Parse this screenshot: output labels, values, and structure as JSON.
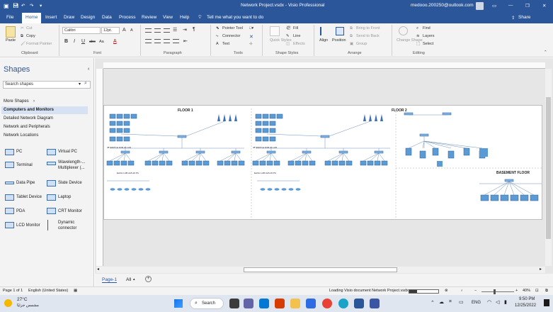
{
  "window": {
    "title": "Network Project.vsdx - Visio Professional",
    "account": "medooo.200250@outlook.com",
    "controls": [
      "—",
      "❐",
      "✕"
    ]
  },
  "ribbon_tabs": [
    "File",
    "Home",
    "Insert",
    "Draw",
    "Design",
    "Data",
    "Process",
    "Review",
    "View",
    "Help"
  ],
  "tell_me": "Tell me what you want to do",
  "share": "Share",
  "ribbon": {
    "clipboard": {
      "paste": "Paste",
      "cut": "Cut",
      "copy": "Copy",
      "format_painter": "Format Painter",
      "label": "Clipboard"
    },
    "font": {
      "family": "Calibri",
      "size": "12pt.",
      "grow": "A",
      "shrink": "A",
      "bold": "B",
      "italic": "I",
      "underline": "U",
      "strike": "abc",
      "case": "Aa",
      "label": "Font"
    },
    "paragraph": {
      "label": "Paragraph"
    },
    "tools": {
      "pointer": "Pointer Tool",
      "connector": "Connector",
      "text": "Text",
      "label": "Tools"
    },
    "shape_styles": {
      "quick_styles": "Quick Styles",
      "fill": "Fill",
      "line": "Line",
      "effects": "Effects",
      "label": "Shape Styles"
    },
    "arrange": {
      "align": "Align",
      "position": "Position",
      "bring_front": "Bring to Front",
      "send_back": "Send to Back",
      "group": "Group",
      "label": "Arrange"
    },
    "editing": {
      "change_shape": "Change Shape",
      "find": "Find",
      "layers": "Layers",
      "select": "Select",
      "label": "Editing"
    }
  },
  "shapes_panel": {
    "title": "Shapes",
    "search_placeholder": "Search shapes",
    "more_shapes": "More Shapes",
    "stencils": [
      "Computers and Monitors",
      "Detailed Network Diagram",
      "Network and Peripherals",
      "Network Locations"
    ],
    "active_stencil": "Computers and Monitors",
    "items": [
      {
        "label": "PC",
        "icon": "pc-icon"
      },
      {
        "label": "Virtual PC",
        "icon": "virtual-pc-icon"
      },
      {
        "label": "Terminal",
        "icon": "terminal-icon"
      },
      {
        "label": "Wavelength-... Multiplexer (...",
        "icon": "multiplexer-icon"
      },
      {
        "label": "Data Pipe",
        "icon": "data-pipe-icon"
      },
      {
        "label": "Slate Device",
        "icon": "slate-device-icon"
      },
      {
        "label": "Tablet Device",
        "icon": "tablet-icon"
      },
      {
        "label": "Laptop",
        "icon": "laptop-icon"
      },
      {
        "label": "PDA",
        "icon": "pda-icon"
      },
      {
        "label": "CRT Monitor",
        "icon": "crt-monitor-icon"
      },
      {
        "label": "LCD Monitor",
        "icon": "lcd-monitor-icon"
      },
      {
        "label": "Dynamic connector",
        "icon": "dynamic-connector-icon"
      }
    ]
  },
  "diagram": {
    "floor1": "FLOOR 1",
    "floor2": "FLOOR 2",
    "basement": "BASEMENT FLOOR",
    "switch_label_1": "48 SWITCH FOR 26 LAN",
    "switch_label_2": "48 SWITCH FOR 26 LAN",
    "lan_label_1": "EACH LAB HAS 26 PC",
    "lan_label_2": "EACH LAB HAS 26 PC"
  },
  "page_tabs": {
    "active": "Page-1",
    "all": "All",
    "add": "+"
  },
  "status": {
    "page": "Page 1 of 1",
    "language": "English (United States)",
    "loading": "Loading Visio document Network Project.vsdx...",
    "zoom": "40%"
  },
  "taskbar": {
    "weather_temp": "27°C",
    "weather_desc": "مشمس جزئيًا",
    "search": "Search",
    "lang": "ENG",
    "time": "9:50 PM",
    "date": "12/25/2022"
  },
  "colors": {
    "brand": "#2b579a",
    "accent_fill": "#4a8ad4",
    "device_fill": "#5b9bd5"
  }
}
